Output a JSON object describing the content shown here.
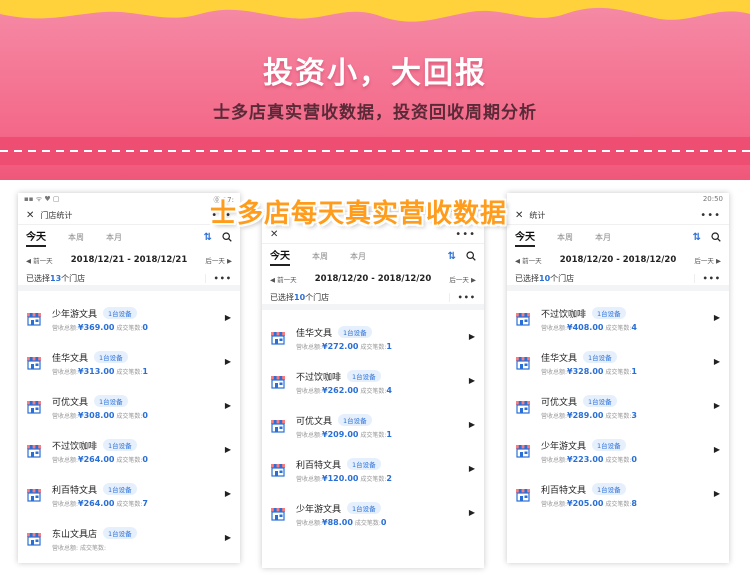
{
  "banner": {
    "title": "投资小，大回报",
    "subtitle": "士多店真实营收数据，投资回收周期分析",
    "overlay_title": "士多店每天真实营收数据"
  },
  "colors": {
    "accent_blue": "#2a6fd6",
    "banner_pink": "#f46a8a",
    "stripe_pink": "#ed4e71",
    "wave_yellow": "#ffd23c",
    "overlay_orange": "#ff9c1c"
  },
  "labels": {
    "revenue_prefix": "营收总额:",
    "count_prefix": "成交笔数:",
    "prev_day": "◀ 前一天",
    "next_day": "后一天 ▶",
    "selected_prefix": "已选择",
    "selected_suffix": "个门店",
    "tab_today": "今天",
    "tab_week": "本周",
    "tab_month": "本月",
    "device_badge": "1台设备"
  },
  "phones": [
    {
      "status_left": "▪▪ ᯤ ♥ ▢",
      "status_right": "⓪ 17:",
      "appbar_title": "门店统计",
      "date_range": "2018/12/21 - 2018/12/21",
      "selected_count": "13",
      "stores": [
        {
          "name": "少年游文具",
          "revenue": "¥369.00",
          "count": "0"
        },
        {
          "name": "佳华文具",
          "revenue": "¥313.00",
          "count": "1"
        },
        {
          "name": "可优文具",
          "revenue": "¥308.00",
          "count": "0"
        },
        {
          "name": "不过饮咖啡",
          "revenue": "¥264.00",
          "count": "0"
        },
        {
          "name": "利百特文具",
          "revenue": "¥264.00",
          "count": "7"
        },
        {
          "name": "东山文具店",
          "revenue": "",
          "count": ""
        }
      ]
    },
    {
      "status_left": "",
      "status_right": "",
      "appbar_title": "",
      "date_range": "2018/12/20 - 2018/12/20",
      "selected_count": "10",
      "stores": [
        {
          "name": "佳华文具",
          "revenue": "¥272.00",
          "count": "1"
        },
        {
          "name": "不过饮咖啡",
          "revenue": "¥262.00",
          "count": "4"
        },
        {
          "name": "可优文具",
          "revenue": "¥209.00",
          "count": "1"
        },
        {
          "name": "利百特文具",
          "revenue": "¥120.00",
          "count": "2"
        },
        {
          "name": "少年游文具",
          "revenue": "¥88.00",
          "count": "0"
        }
      ]
    },
    {
      "status_left": "",
      "status_right": "20:50",
      "appbar_title": "统计",
      "date_range": "2018/12/20 - 2018/12/20",
      "selected_count": "10",
      "stores": [
        {
          "name": "不过饮咖啡",
          "revenue": "¥408.00",
          "count": "4"
        },
        {
          "name": "佳华文具",
          "revenue": "¥328.00",
          "count": "1"
        },
        {
          "name": "可优文具",
          "revenue": "¥289.00",
          "count": "3"
        },
        {
          "name": "少年游文具",
          "revenue": "¥223.00",
          "count": "0"
        },
        {
          "name": "利百特文具",
          "revenue": "¥205.00",
          "count": "8"
        }
      ]
    }
  ]
}
